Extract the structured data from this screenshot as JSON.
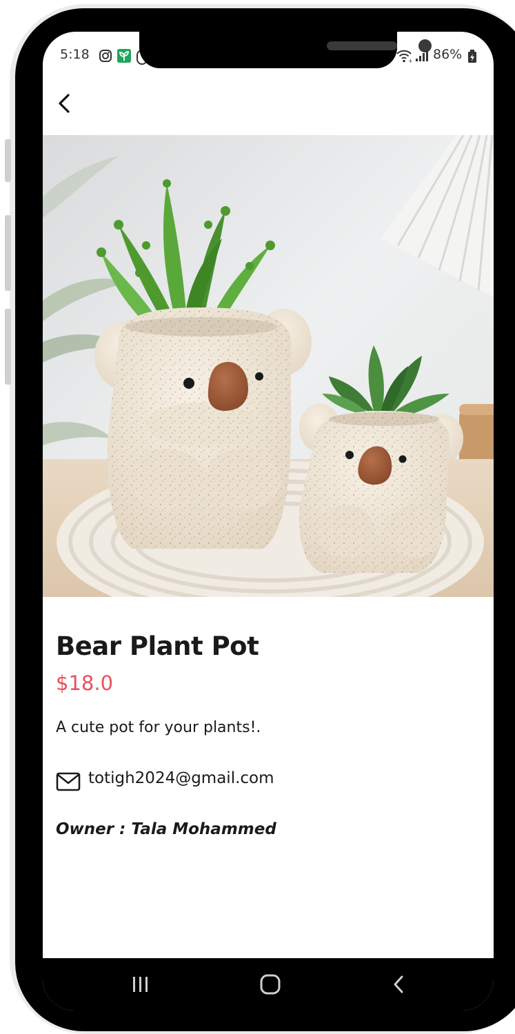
{
  "status_bar": {
    "time": "5:18",
    "battery": "86%",
    "icons": [
      "instagram-icon",
      "app-icon",
      "wifi-icon",
      "signal-icon",
      "battery-icon"
    ]
  },
  "header": {
    "back_icon": "chevron-left-icon"
  },
  "product": {
    "title": "Bear Plant Pot",
    "price": "$18.0",
    "description": "A cute pot for your plants!.",
    "email": "totigh2024@gmail.com",
    "owner_label": "Owner : ",
    "owner_name": "Tala Mohammed",
    "image": "koala-plant-pots-photo"
  },
  "nav_bar": {
    "recents_icon": "recents-icon",
    "home_icon": "home-icon",
    "back_icon": "back-nav-icon"
  },
  "colors": {
    "price": "#e8505b",
    "text": "#1a1a1a",
    "frame": "#000000"
  }
}
